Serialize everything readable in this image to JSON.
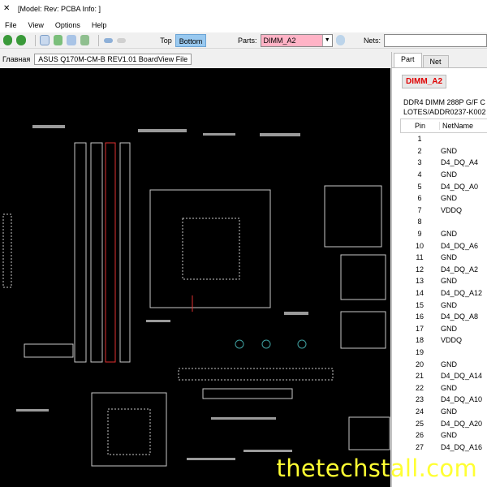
{
  "window": {
    "title": "[Model: Rev:  PCBA Info: ]"
  },
  "menu": [
    "File",
    "View",
    "Options",
    "Help"
  ],
  "toolbar": {
    "side_label_top": "Top",
    "side_label_bottom": "Bottom",
    "parts_label": "Parts:",
    "parts_value": "DIMM_A2",
    "nets_label": "Nets:",
    "nets_value": ""
  },
  "path": {
    "label": "Главная",
    "file": "ASUS Q170M-CM-B REV1.01 BoardView File"
  },
  "panel": {
    "tabs": [
      "Part",
      "Net"
    ],
    "part_name": "DIMM_A2",
    "description_line1": "DDR4 DIMM 288P G/F C",
    "description_line2": "LOTES/ADDR0237-K002",
    "columns": [
      "Pin",
      "NetName"
    ],
    "rows": [
      {
        "pin": "1",
        "net": ""
      },
      {
        "pin": "2",
        "net": "GND"
      },
      {
        "pin": "3",
        "net": "D4_DQ_A4"
      },
      {
        "pin": "4",
        "net": "GND"
      },
      {
        "pin": "5",
        "net": "D4_DQ_A0"
      },
      {
        "pin": "6",
        "net": "GND"
      },
      {
        "pin": "7",
        "net": "VDDQ"
      },
      {
        "pin": "8",
        "net": ""
      },
      {
        "pin": "9",
        "net": "GND"
      },
      {
        "pin": "10",
        "net": "D4_DQ_A6"
      },
      {
        "pin": "11",
        "net": "GND"
      },
      {
        "pin": "12",
        "net": "D4_DQ_A2"
      },
      {
        "pin": "13",
        "net": "GND"
      },
      {
        "pin": "14",
        "net": "D4_DQ_A12"
      },
      {
        "pin": "15",
        "net": "GND"
      },
      {
        "pin": "16",
        "net": "D4_DQ_A8"
      },
      {
        "pin": "17",
        "net": "GND"
      },
      {
        "pin": "18",
        "net": "VDDQ"
      },
      {
        "pin": "19",
        "net": ""
      },
      {
        "pin": "20",
        "net": "GND"
      },
      {
        "pin": "21",
        "net": "D4_DQ_A14"
      },
      {
        "pin": "22",
        "net": "GND"
      },
      {
        "pin": "23",
        "net": "D4_DQ_A10"
      },
      {
        "pin": "24",
        "net": "GND"
      },
      {
        "pin": "25",
        "net": "D4_DQ_A20"
      },
      {
        "pin": "26",
        "net": "GND"
      },
      {
        "pin": "27",
        "net": "D4_DQ_A16"
      }
    ]
  },
  "watermark": "thetechstall.com",
  "colors": {
    "highlight": "#e00000",
    "parts_bg": "#ffb3c6",
    "active_side": "#99c9f0",
    "watermark": "#ffff33"
  },
  "icons": [
    "app-icon",
    "zoom-in-icon",
    "zoom-out-icon",
    "fit-icon",
    "zoom-area-icon",
    "zoom-part-icon",
    "back-arrow-icon",
    "forward-arrow-icon",
    "search-icon"
  ]
}
